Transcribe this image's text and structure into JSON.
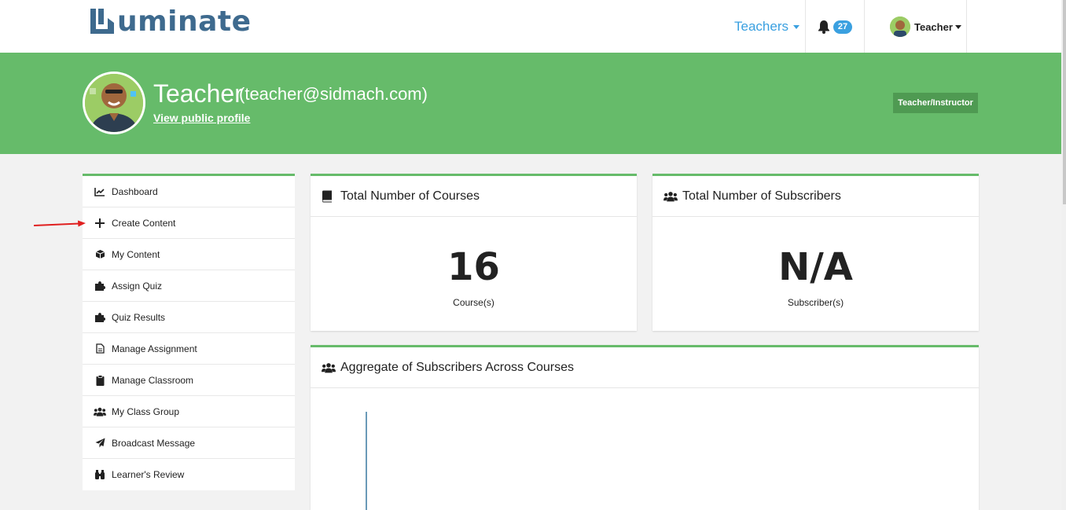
{
  "brand": {
    "logo_text": "uminate"
  },
  "navbar": {
    "teachers_label": "Teachers",
    "notification_count": "27",
    "user_label": "Teacher"
  },
  "profile": {
    "name": "Teacher",
    "email": "(teacher@sidmach.com)",
    "view_profile_link": "View public profile",
    "role_badge": "Teacher/Instructor"
  },
  "sidebar": {
    "items": [
      {
        "label": "Dashboard",
        "icon": "chart-line-icon"
      },
      {
        "label": "Create Content",
        "icon": "plus-icon"
      },
      {
        "label": "My Content",
        "icon": "cube-icon"
      },
      {
        "label": "Assign Quiz",
        "icon": "puzzle-icon"
      },
      {
        "label": "Quiz Results",
        "icon": "puzzle-icon"
      },
      {
        "label": "Manage Assignment",
        "icon": "file-icon"
      },
      {
        "label": "Manage Classroom",
        "icon": "clipboard-icon"
      },
      {
        "label": "My Class Group",
        "icon": "users-icon"
      },
      {
        "label": "Broadcast Message",
        "icon": "paper-plane-icon"
      },
      {
        "label": "Learner's Review",
        "icon": "binoculars-icon"
      }
    ]
  },
  "cards": {
    "courses": {
      "title": "Total Number of Courses",
      "value": "16",
      "unit": "Course(s)"
    },
    "subscribers": {
      "title": "Total Number of Subscribers",
      "value": "N/A",
      "unit": "Subscriber(s)"
    },
    "aggregate": {
      "title": "Aggregate of Subscribers Across Courses"
    }
  },
  "colors": {
    "accent_green": "#66bb6a",
    "link_blue": "#3aa0e0",
    "logo_blue": "#3e6a8e",
    "annotation_red": "#e02020"
  }
}
